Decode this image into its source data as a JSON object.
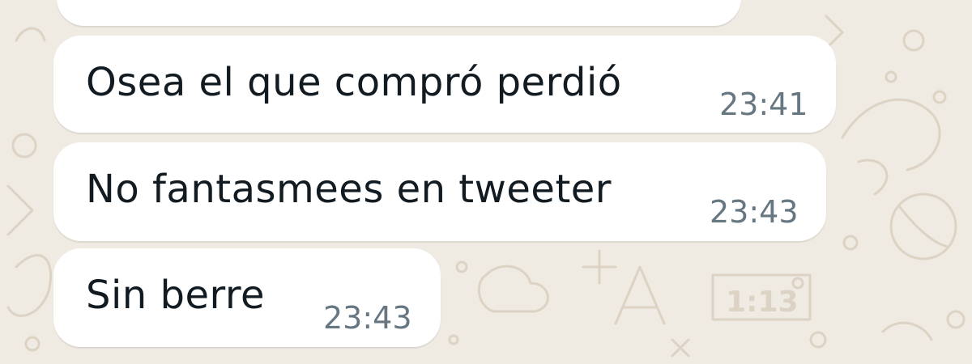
{
  "chat": {
    "messages": [
      {
        "text": "Osea el que compró perdió",
        "time": "23:41"
      },
      {
        "text": "No fantasmees en tweeter",
        "time": "23:43"
      },
      {
        "text": "Sin berre",
        "time": "23:43"
      }
    ]
  },
  "background": {
    "clock_doodle_text": "1:13"
  },
  "colors": {
    "wallpaper": "#efeae2",
    "bubble": "#ffffff",
    "message_text": "#111b21",
    "timestamp_text": "#667781"
  }
}
